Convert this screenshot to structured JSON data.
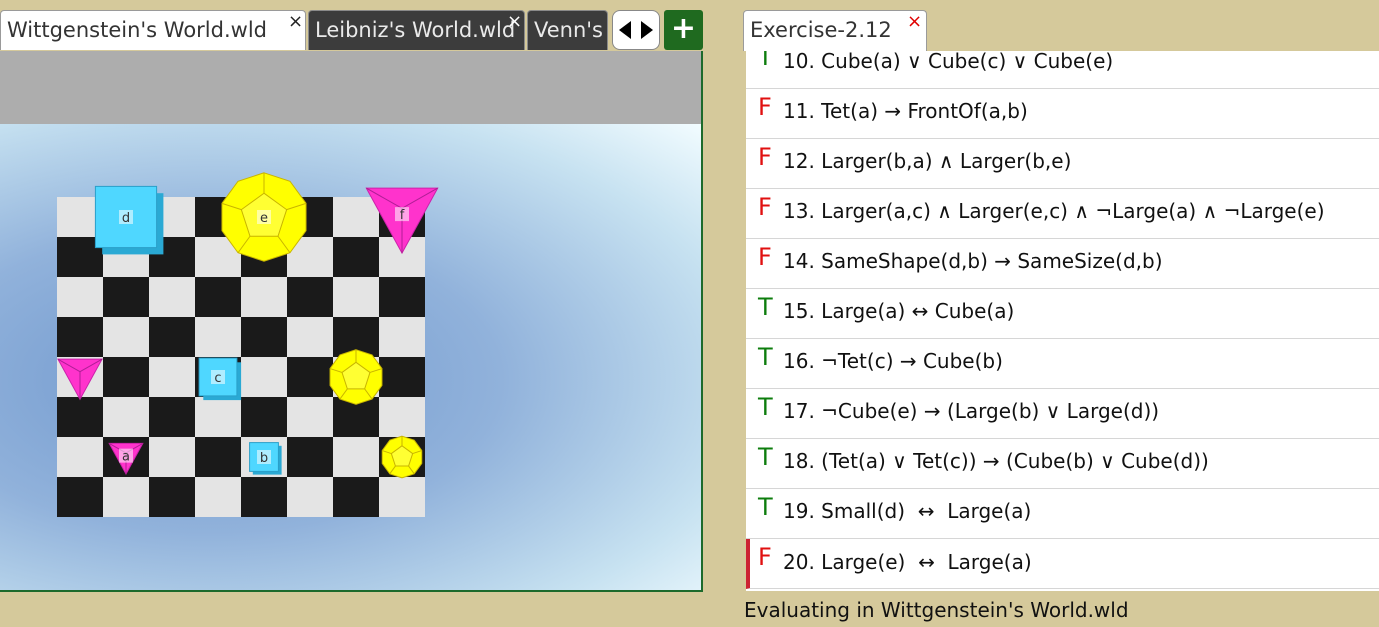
{
  "left_tabs": [
    {
      "label": "Wittgenstein's World.wld",
      "close": "×",
      "active": true
    },
    {
      "label": "Leibniz's World.wld",
      "close": "×",
      "active": false
    },
    {
      "label": "Venn's World.wld",
      "close": "",
      "active": false
    }
  ],
  "tab_scroll": {
    "left_icon": "triangle-left-icon",
    "right_icon": "triangle-right-icon"
  },
  "add_tab_label": "+",
  "exercise_tab": {
    "label": "Exercise-2.12",
    "close": "×"
  },
  "world": {
    "objects": [
      {
        "label": "a",
        "shape": "tet",
        "size": "small",
        "color": "#ff33cc",
        "col": 1,
        "row": 6
      },
      {
        "label": "b",
        "shape": "cube",
        "size": "small",
        "color": "#4fd7ff",
        "col": 4,
        "row": 6
      },
      {
        "label": "c",
        "shape": "cube",
        "size": "medium",
        "color": "#4fd7ff",
        "col": 3,
        "row": 4
      },
      {
        "label": "d",
        "shape": "cube",
        "size": "large",
        "color": "#4fd7ff",
        "col": 1,
        "row": 0
      },
      {
        "label": "e",
        "shape": "dodec",
        "size": "large",
        "color": "#ffff00",
        "col": 4,
        "row": 0
      },
      {
        "label": "f",
        "shape": "tet",
        "size": "large",
        "color": "#ff33cc",
        "col": 7,
        "row": 0
      },
      {
        "label": "",
        "shape": "tet",
        "size": "medium",
        "color": "#ff33cc",
        "col": 0,
        "row": 4
      },
      {
        "label": "",
        "shape": "dodec",
        "size": "medium",
        "color": "#ffff00",
        "col": 6,
        "row": 4
      },
      {
        "label": "",
        "shape": "dodec",
        "size": "small",
        "color": "#ffff00",
        "col": 7,
        "row": 6
      }
    ]
  },
  "sentences": [
    {
      "tv": "T",
      "num": "10.",
      "text": "Cube(a) ∨ Cube(c) ∨ Cube(e)"
    },
    {
      "tv": "F",
      "num": "11.",
      "text": "Tet(a) → FrontOf(a,b)"
    },
    {
      "tv": "F",
      "num": "12.",
      "text": "Larger(b,a) ∧ Larger(b,e)"
    },
    {
      "tv": "F",
      "num": "13.",
      "text": "Larger(a,c) ∧ Larger(e,c) ∧ ¬Large(a) ∧ ¬Large(e)"
    },
    {
      "tv": "F",
      "num": "14.",
      "text": "SameShape(d,b) → SameSize(d,b)"
    },
    {
      "tv": "T",
      "num": "15.",
      "text": "Large(a) ↔ Cube(a)"
    },
    {
      "tv": "T",
      "num": "16.",
      "text": "¬Tet(c) → Cube(b)"
    },
    {
      "tv": "T",
      "num": "17.",
      "text": "¬Cube(e) → (Large(b) ∨ Large(d))"
    },
    {
      "tv": "T",
      "num": "18.",
      "text": "(Tet(a) ∨ Tet(c)) → (Cube(b) ∨ Cube(d))"
    },
    {
      "tv": "T",
      "num": "19.",
      "text": "Small(d)  ↔  Large(a)"
    },
    {
      "tv": "F",
      "num": "20.",
      "text": " Large(e)  ↔  Large(a)",
      "selected": true
    }
  ],
  "status": "Evaluating in Wittgenstein's World.wld"
}
